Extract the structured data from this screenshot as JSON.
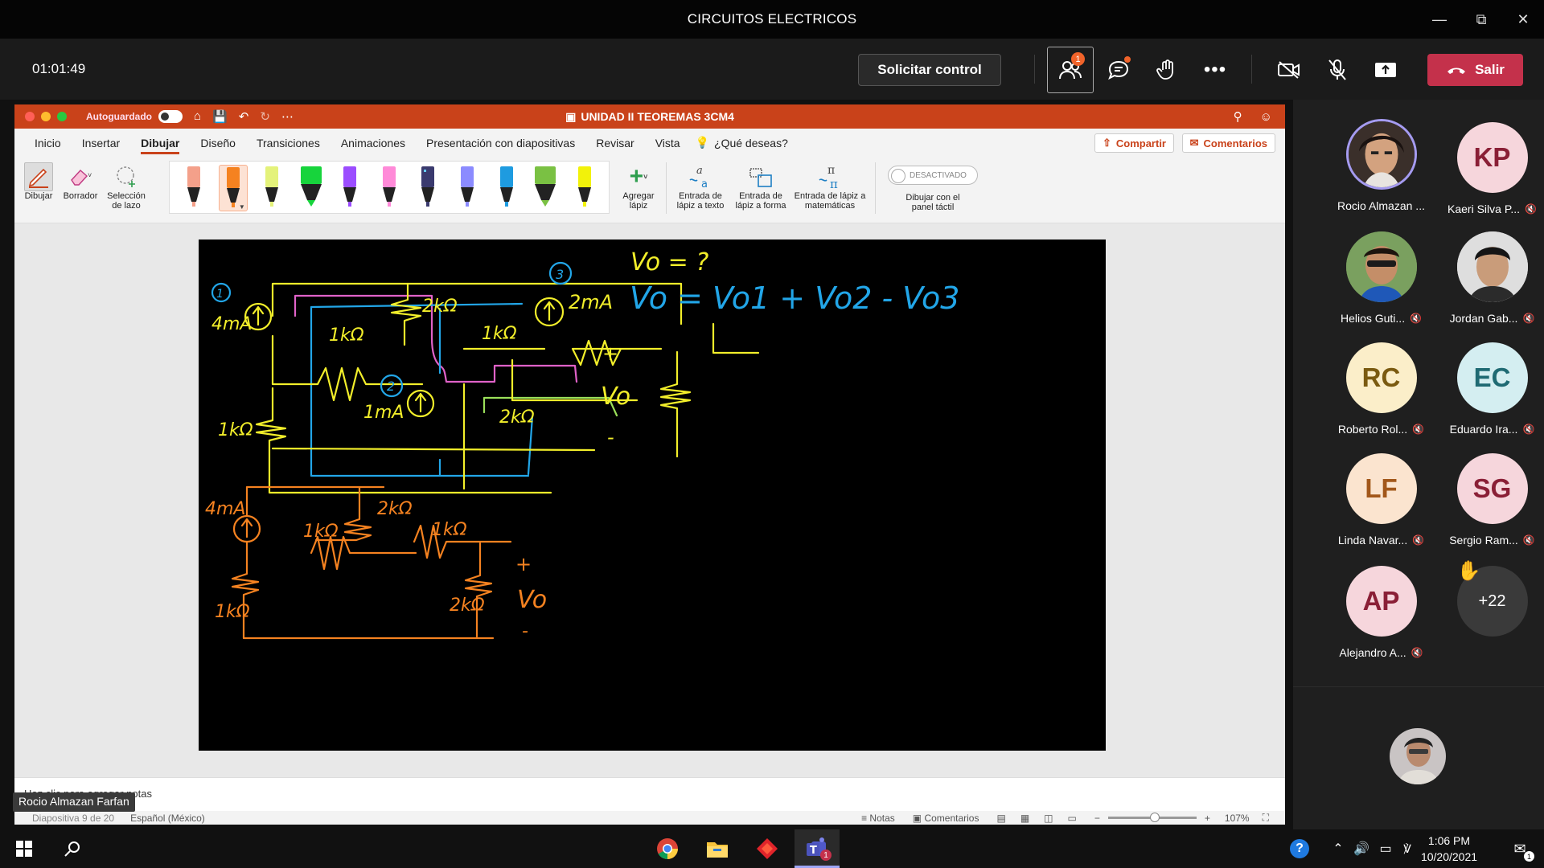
{
  "window": {
    "title": "CIRCUITOS ELECTRICOS"
  },
  "meeting": {
    "timer": "01:01:49",
    "request_control": "Solicitar control",
    "participants_badge": "1",
    "leave_label": "Salir",
    "leave_color": "#c4314b"
  },
  "ppt": {
    "autosave": "Autoguardado",
    "autosave_state": "o",
    "doc_title": "UNIDAD II TEOREMAS 3CM4",
    "menu": [
      "Inicio",
      "Insertar",
      "Dibujar",
      "Diseño",
      "Transiciones",
      "Animaciones",
      "Presentación con diapositivas",
      "Revisar",
      "Vista"
    ],
    "active_menu": "Dibujar",
    "tell_me": "¿Qué deseas?",
    "share": "Compartir",
    "comments": "Comentarios",
    "tools": {
      "draw": "Dibujar",
      "eraser": "Borrador",
      "lasso": "Selección de lazo",
      "add_pen": "Agregar lápiz",
      "ink_text": "Entrada de lápiz a texto",
      "ink_shape": "Entrada de lápiz a forma",
      "ink_math": "Entrada de lápiz a matemáticas",
      "touch_draw": "Dibujar con el panel táctil",
      "touch_state": "DESACTIVADO"
    },
    "pen_colors": [
      "#f4a08a",
      "#f58220",
      "#e4f27a",
      "#17d43c",
      "#9b4dff",
      "#ff8ad8",
      "#3a3a6e",
      "#8b8bff",
      "#1e9be0",
      "#7ac143",
      "#f2f20a"
    ],
    "notes_placeholder": "Haz clic para agregar notas",
    "status": {
      "slide": "Diapositiva 9 de 20",
      "language": "Español (México)",
      "notes": "Notas",
      "comments": "Comentarios",
      "zoom": "107%"
    },
    "slide_ink": {
      "vo_question": "Vo = ?",
      "vo_equation": "Vo = Vo1 + Vo2 - Vo3",
      "label_circle1": "1",
      "label_circle2": "2",
      "label_circle3": "3",
      "i1": "4mA",
      "i2": "1mA",
      "i3": "2mA",
      "r_top": "2kΩ",
      "r_mid_left": "1kΩ",
      "r_mid_right": "1kΩ",
      "r_left": "1kΩ",
      "r_right": "2kΩ",
      "plus": "+",
      "minus": "-",
      "vo": "Vo",
      "b_i1": "4mA",
      "b_r_top": "2kΩ",
      "b_r_mid": "1kΩ",
      "b_r_mid2": "1kΩ",
      "b_r_left": "1kΩ",
      "b_r_right": "2kΩ",
      "b_vo": "Vo",
      "b_plus": "+",
      "b_minus": "-"
    }
  },
  "presenter_label": "Rocio Almazan Farfan",
  "roster": [
    {
      "name": "Rocio Almazan ...",
      "initials": "",
      "type": "photo-woman",
      "muted": false
    },
    {
      "name": "Kaeri Silva P...",
      "initials": "KP",
      "bg": "#f6d6dc",
      "fg": "#8a1f36",
      "muted": true
    },
    {
      "name": "Helios Guti...",
      "initials": "",
      "type": "photo-man1",
      "muted": true
    },
    {
      "name": "Jordan Gab...",
      "initials": "",
      "type": "photo-man2",
      "muted": true
    },
    {
      "name": "Roberto Rol...",
      "initials": "RC",
      "bg": "#fbeec9",
      "fg": "#7a5a10",
      "muted": true
    },
    {
      "name": "Eduardo Ira...",
      "initials": "EC",
      "bg": "#d4eef1",
      "fg": "#1f6a73",
      "muted": true
    },
    {
      "name": "Linda Navar...",
      "initials": "LF",
      "bg": "#fbe4cf",
      "fg": "#a2571a",
      "muted": true
    },
    {
      "name": "Sergio Ram...",
      "initials": "SG",
      "bg": "#f6d6dc",
      "fg": "#8a1f36",
      "muted": true
    },
    {
      "name": "Alejandro A...",
      "initials": "AP",
      "bg": "#f6d6dc",
      "fg": "#8a1f36",
      "muted": true
    },
    {
      "name": "",
      "initials": "+22",
      "bg": "#3a3a3a",
      "fg": "#ffffff",
      "muted": false,
      "raised_hand": true
    }
  ],
  "taskbar": {
    "time": "1:06 PM",
    "date": "10/20/2021",
    "teams_badge": "1",
    "notif_badge": "1"
  }
}
